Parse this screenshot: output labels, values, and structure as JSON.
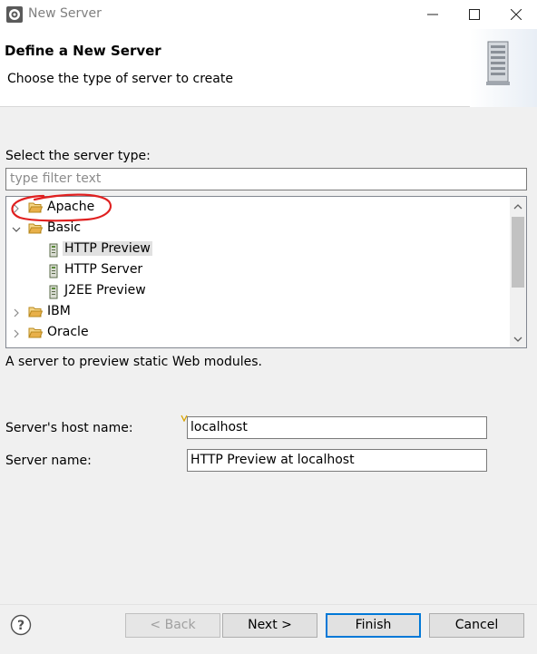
{
  "window": {
    "title": "New Server"
  },
  "header": {
    "title": "Define a New Server",
    "description": "Choose the type of server to create"
  },
  "server_type": {
    "label": "Select the server type:",
    "filter_placeholder": "type filter text",
    "tree": [
      {
        "label": "Apache",
        "kind": "folder",
        "expanded": false
      },
      {
        "label": "Basic",
        "kind": "folder",
        "expanded": true
      },
      {
        "label": "HTTP Preview",
        "kind": "server",
        "selected": true
      },
      {
        "label": "HTTP Server",
        "kind": "server"
      },
      {
        "label": "J2EE Preview",
        "kind": "server"
      },
      {
        "label": "IBM",
        "kind": "folder",
        "expanded": false
      },
      {
        "label": "Oracle",
        "kind": "folder",
        "expanded": false
      }
    ],
    "description": "A server to preview static Web modules."
  },
  "fields": {
    "host_label": "Server's host name:",
    "host_value": "localhost",
    "name_label": "Server name:",
    "name_value": "HTTP Preview at localhost"
  },
  "buttons": {
    "back": "< Back",
    "next": "Next >",
    "finish": "Finish",
    "cancel": "Cancel"
  },
  "colors": {
    "accent": "#0078d7",
    "annotation": "#e02020",
    "folder": "#e8b04a"
  }
}
